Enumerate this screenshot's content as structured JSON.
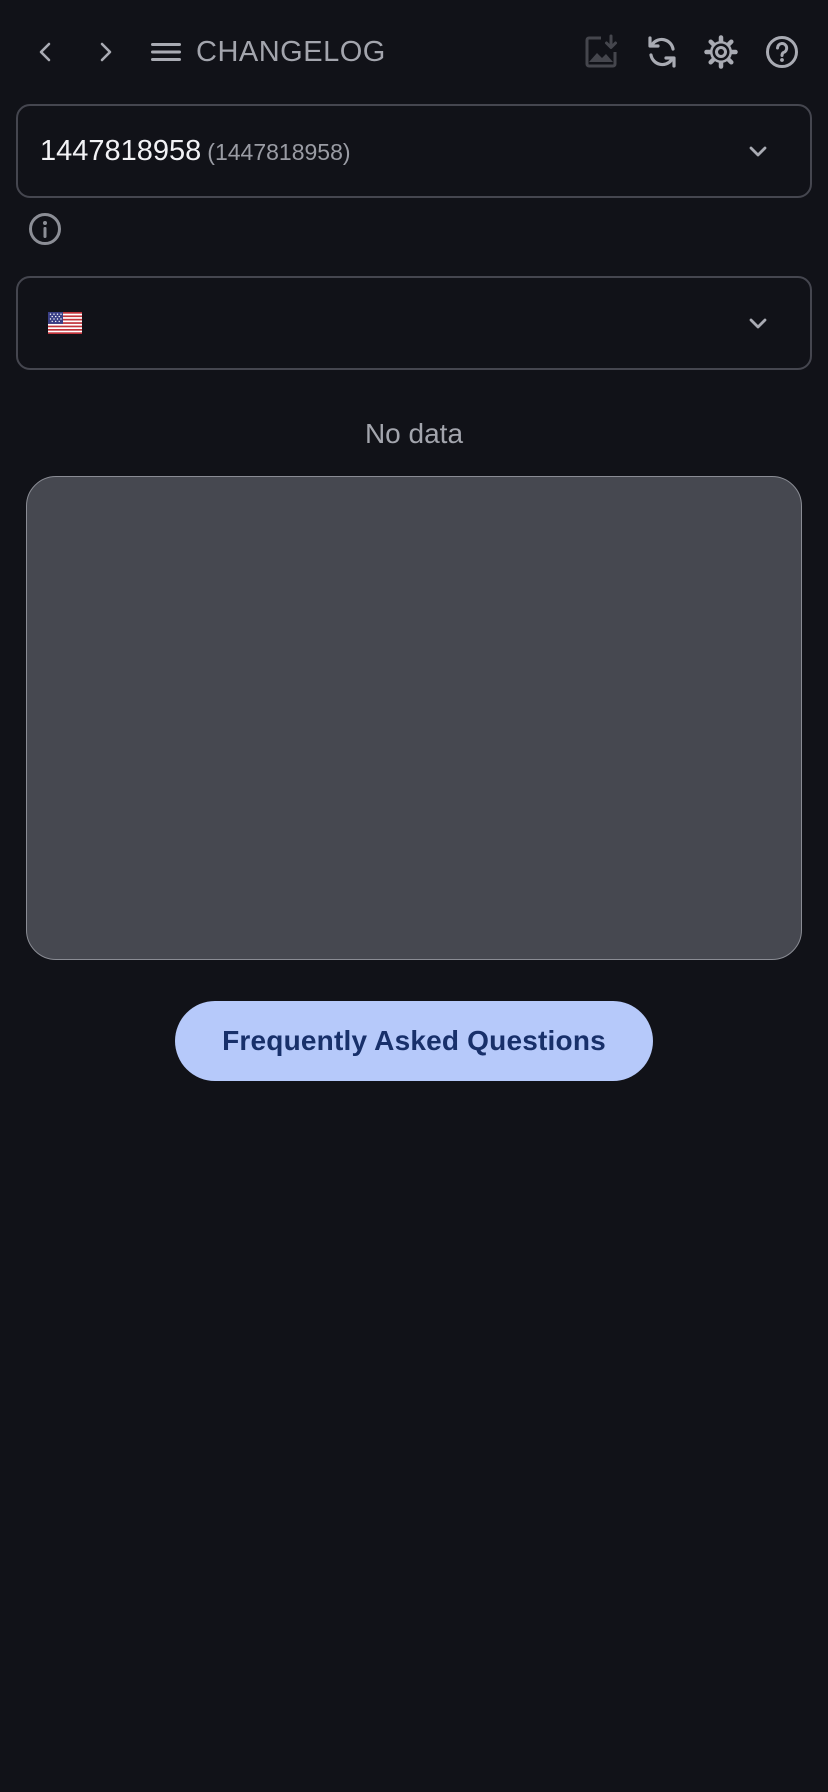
{
  "header": {
    "title": "CHANGELOG",
    "icons": {
      "back": "chevron-left-icon",
      "forward": "chevron-right-icon",
      "menu": "menu-icon",
      "save_image": "image-download-icon",
      "refresh": "refresh-icon",
      "settings": "gear-icon",
      "help": "help-circle-icon"
    }
  },
  "app_select": {
    "value": "1447818958",
    "secondary": "(1447818958)"
  },
  "country_select": {
    "flag": "us-flag-icon",
    "value": ""
  },
  "empty_state": {
    "text": "No data"
  },
  "faq_button": {
    "label": "Frequently Asked Questions"
  },
  "colors": {
    "background": "#111218",
    "card": "#464850",
    "accent": "#b6c9fa",
    "accent_text": "#18306a"
  }
}
